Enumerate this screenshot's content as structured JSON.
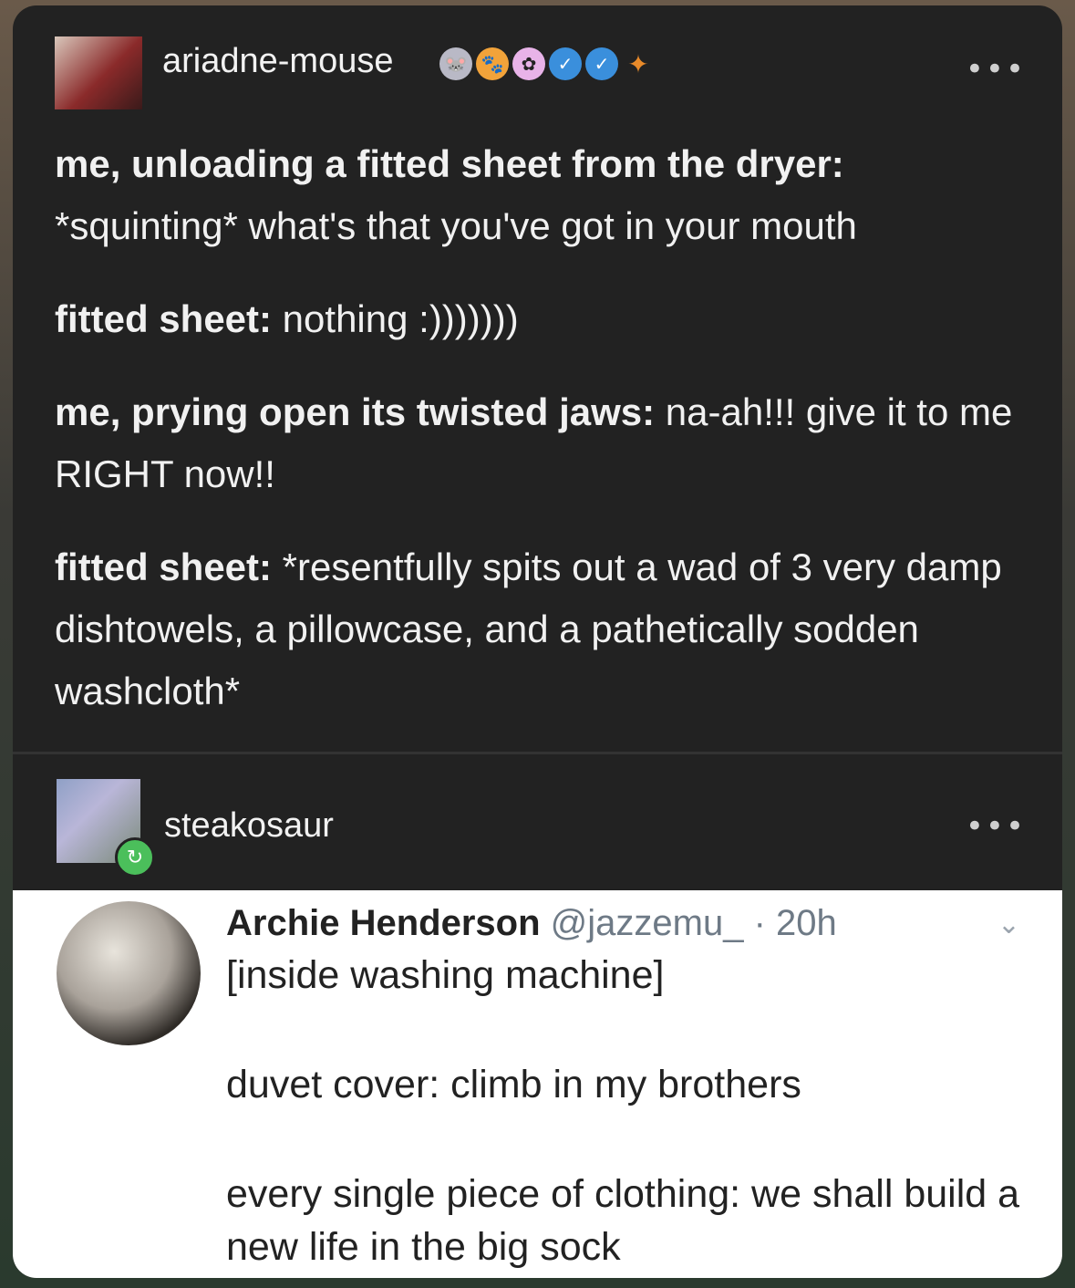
{
  "post": {
    "username": "ariadne-mouse",
    "badges": [
      {
        "name": "mouse-badge-icon",
        "color": "#b9b9c6"
      },
      {
        "name": "paw-badge-icon",
        "color": "#f2a33a"
      },
      {
        "name": "flower-badge-icon",
        "color": "#e8b3e8"
      },
      {
        "name": "verified-badge-icon",
        "color": "#3a8fdc"
      },
      {
        "name": "verified-badge-icon",
        "color": "#3a8fdc"
      },
      {
        "name": "crab-badge-icon",
        "color": "#e88a2a"
      }
    ],
    "more": "•••",
    "lines": [
      {
        "b": "me, unloading a fitted sheet from the dryer:",
        "t": " *squinting* what's that you've got in your mouth"
      },
      {
        "b": "fitted sheet:",
        "t": " nothing :)))))))"
      },
      {
        "b": "me, prying open its twisted jaws:",
        "t": " na-ah!!! give it to me RIGHT now!!"
      },
      {
        "b": "fitted sheet:",
        "t": " *resentfully spits out a wad of 3 very damp dishtowels, a pillowcase, and a pathetically sodden washcloth*"
      }
    ]
  },
  "reblog": {
    "username": "steakosaur",
    "more": "•••",
    "reblog_icon": "↻"
  },
  "tweet": {
    "name": "Archie Henderson",
    "handle": "@jazzemu_",
    "time": "· 20h",
    "chevron": "⌄",
    "paras": [
      "[inside washing machine]",
      "duvet cover: climb in my brothers",
      "every single piece of clothing: we shall build a new life in the big sock"
    ]
  }
}
